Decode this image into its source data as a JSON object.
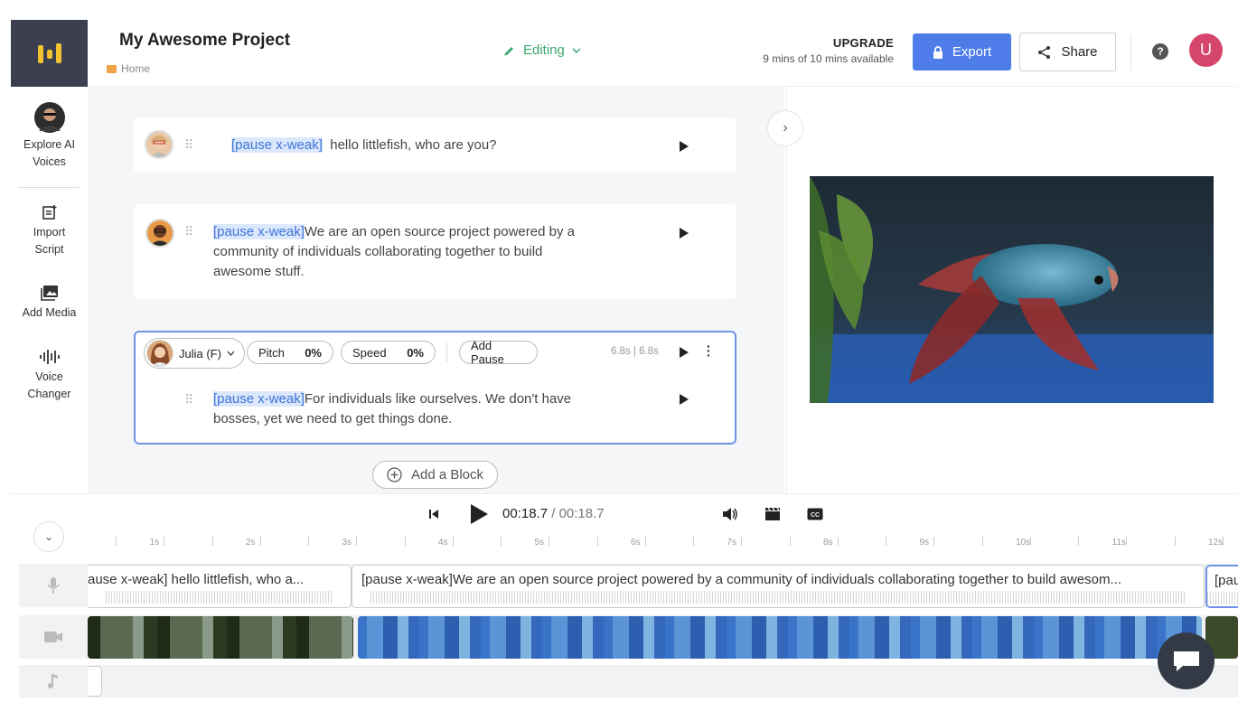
{
  "header": {
    "project_title": "My Awesome Project",
    "breadcrumb": "Home",
    "mode": "Editing",
    "upgrade_label": "UPGRADE",
    "usage": "9 mins of 10 mins available",
    "export_label": "Export",
    "share_label": "Share",
    "user_initial": "U"
  },
  "sidebar": {
    "items": [
      {
        "label_line1": "Explore AI",
        "label_line2": "Voices"
      },
      {
        "label_line1": "Import",
        "label_line2": "Script"
      },
      {
        "label_line1": "Add Media",
        "label_line2": ""
      },
      {
        "label_line1": "Voice",
        "label_line2": "Changer"
      }
    ]
  },
  "blocks": [
    {
      "pause": "[pause x-weak]",
      "text": "hello littlefish, who are you?"
    },
    {
      "pause": "[pause x-weak]",
      "text_line1": "We are an open source project powered by a",
      "text_line2": "community of individuals collaborating together to build",
      "text_line3": "awesome stuff."
    },
    {
      "voice": "Julia (F)",
      "pitch_label": "Pitch",
      "pitch_value": "0%",
      "speed_label": "Speed",
      "speed_value": "0%",
      "add_pause": "Add Pause",
      "duration": "6.8s | 6.8s",
      "pause": "[pause x-weak]",
      "text_line1": "For individuals like ourselves. We don't have",
      "text_line2": "bosses, yet we need to get things done."
    }
  ],
  "add_block_label": "Add a Block",
  "transport": {
    "current": "00:18.7",
    "separator": "/",
    "total": "00:18.7"
  },
  "ruler": {
    "labels": [
      "1s",
      "2s",
      "3s",
      "4s",
      "5s",
      "6s",
      "7s",
      "8s",
      "9s",
      "10s",
      "11s",
      "12s"
    ]
  },
  "timeline": {
    "voice_clips": [
      "ause x-weak] hello littlefish, who a...",
      "[pause x-weak]We are an open source project powered by a community of individuals collaborating together to build awesom...",
      "[pau"
    ]
  },
  "colors": {
    "accent": "#4e7de9",
    "editing": "#3aa76d",
    "pause_bg": "#dbe7fb",
    "avatar": "#d6466c"
  }
}
